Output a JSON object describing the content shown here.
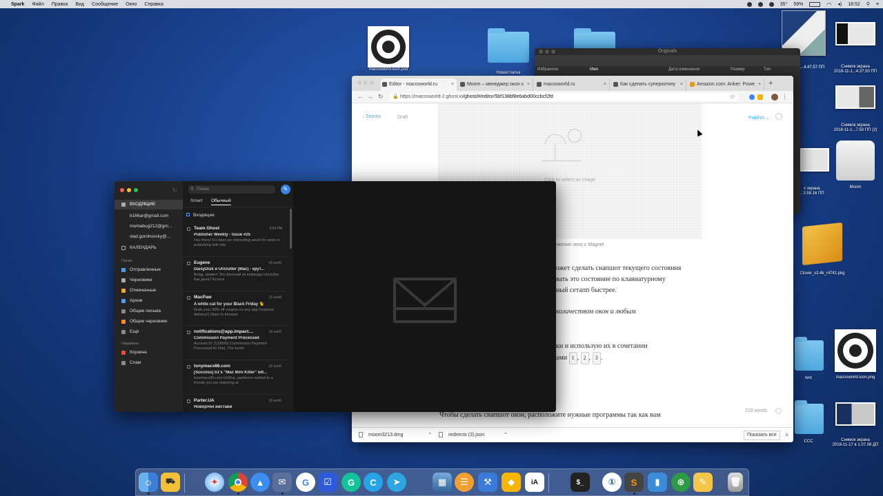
{
  "menubar": {
    "app": "Spark",
    "items": [
      "Файл",
      "Правка",
      "Вид",
      "Сообщение",
      "Окно",
      "Справка"
    ],
    "status": {
      "temp": "35°",
      "battery": "59%",
      "time": "18:52"
    }
  },
  "desktop": {
    "icons": [
      {
        "label": "macosworld-icon.psd"
      },
      {
        "label": "Новая папка"
      },
      {
        "label": "Снимок экрана\n2018-11-1...4.37.50 ПП"
      },
      {
        "label": "Снимок экрана\n2018-11-1...7.50 ПП (2)"
      },
      {
        "label": "Moom"
      },
      {
        "label": "к экрана\n...3.58.16 ПП"
      },
      {
        "label": "Clover_v2.4k_r4741.pkg"
      },
      {
        "label": "test"
      },
      {
        "label": "macosworld-icon.png"
      },
      {
        "label": "CCC"
      },
      {
        "label": "Снимок экрана\n2018-11-17 в 1.07.06 ДП"
      }
    ]
  },
  "finder": {
    "title": "Originals",
    "sidebar_label": "Избранное",
    "columns": [
      "Имя",
      "Дата изменения",
      "Размер",
      "Тип"
    ],
    "timestamp": "...4.47.57 ПП"
  },
  "chrome": {
    "tabs": [
      {
        "label": "Editor - macosworld.ru"
      },
      {
        "label": "Moom – менеджер окон с"
      },
      {
        "label": "macosworld.ru"
      },
      {
        "label": "Как сделать суперхоткну"
      },
      {
        "label": "Amazon.com: Anker: Powe"
      }
    ],
    "url_host": "https://macosworld-2.ghost.io",
    "url_path": "/ghost/#/editor/5bf138bf8e6abd00ccbcf2fd",
    "editor": {
      "stories_label": "Stories",
      "status": "Draft",
      "publish_label": "Publish",
      "image_placeholder": "Click to select an image",
      "caption_fragment": "ложение окно с Magnet",
      "para1": [
        "ожет сделать снапшот текущего состояния",
        "вать это состояние по клавиатурному",
        "ный сетапп быстрее."
      ],
      "italic_line": "количеством окон и любым",
      "para2a": "ки и использую их в сочетании",
      "para2b": "ами",
      "keys": [
        "1",
        "2",
        "3"
      ],
      "word_count": "218 words",
      "bottom_text": "Чтобы сделать снапшот окон, расположите нужные программы так как вам"
    },
    "downloads": [
      {
        "name": "moom3213.dmg"
      },
      {
        "name": "redirects (3).json"
      }
    ],
    "show_all": "Показать все"
  },
  "spark": {
    "search_placeholder": "Поиск",
    "tabs": [
      "Smart",
      "Обычный"
    ],
    "sidebar": {
      "inbox": "ВХОДЯЩИЕ",
      "accounts": [
        "b166ar@gmail.com",
        "merbabug212@gm...",
        "vlad.gorohovsky@..."
      ],
      "calendar": "КАЛЕНДАРЬ",
      "folders_header": "Папки",
      "folders": [
        "Отправленные",
        "Черновики",
        "Отмеченные",
        "Архив",
        "Общие письма",
        "Общие черновики",
        "Ещё"
      ],
      "recent_header": "Недавние",
      "recent": [
        "Корзина",
        "Спам"
      ]
    },
    "list_header": "Входящие",
    "mails": [
      {
        "from": "Team Ghost",
        "date": "2:09 PM",
        "subject": "Publisher Weekly - Issue #25",
        "preview": "Hey there! It's been an interesting week for news in publishing with lots"
      },
      {
        "from": "Eugene",
        "date": "16 нояб.",
        "subject": "DaisyDisk и Unclutter (Mac) - крут...",
        "preview": "Влад, привет! Это Евгений из команды Unclutter. Как дела? Если в"
      },
      {
        "from": "MacPaw",
        "date": "16 нояб.",
        "subject": "A white cat for your Black Friday 🐈",
        "preview": "Grab your 30% off coupon on any app (surprise delivery!) Open in browser"
      },
      {
        "from": "notifications@app.impact....",
        "date": "16 нояб.",
        "subject": "Commission Payment Processed",
        "preview": "Account ID (123000) Commission Payment Processed Hi Vlad, The funds"
      },
      {
        "from": "tonymacx86.com",
        "date": "16 нояб.",
        "subject": "[Success] b1's \"Mac Mini Killer\" wit...",
        "preview": "tonymacx86.com b166ar, partimers replied to a thread you are watching at"
      },
      {
        "from": "Parter.UA",
        "date": "16 нояб.",
        "subject": "Новорічні вистави",
        "preview": ""
      }
    ]
  },
  "dock": {
    "apps": [
      "Finder",
      "Preview",
      "Safari",
      "Chrome",
      "Mail",
      "Spark",
      "Google",
      "Tasks",
      "Grammarly",
      "Code",
      "Telegram",
      "Photos",
      "Sequel",
      "Xcode",
      "Sketch",
      "iA Writer",
      "Terminal",
      "1Password",
      "Sublime",
      "Activity",
      "Maps",
      "Notes",
      "Trash"
    ]
  }
}
